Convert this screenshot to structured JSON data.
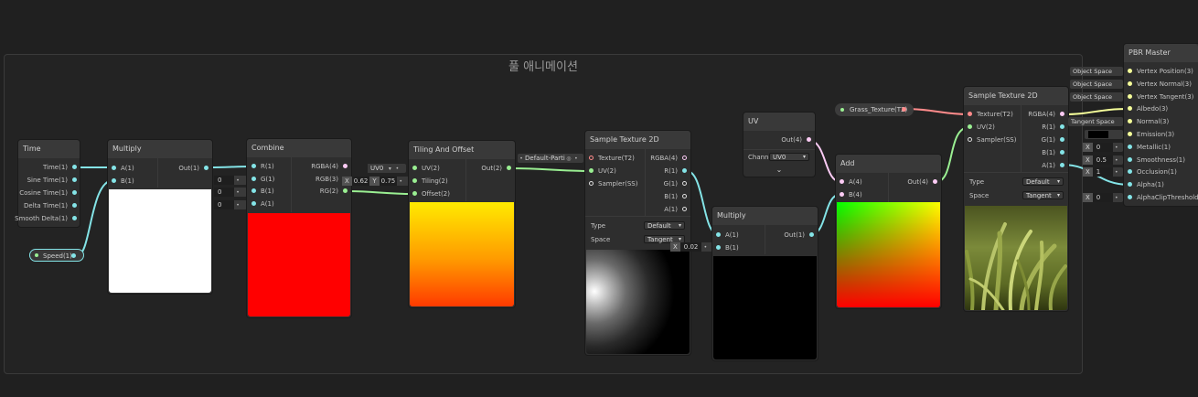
{
  "group_title": "풀 애니메이션",
  "colors": {
    "float": "#84e4e7",
    "vec2": "#9aef92",
    "vec3": "#f6ff9a",
    "vec4": "#fbcbf4",
    "texture": "#ff8b8b",
    "sampler": "#dddddd"
  },
  "time_node": {
    "title": "Time",
    "outputs": [
      "Time(1)",
      "Sine Time(1)",
      "Cosine Time(1)",
      "Delta Time(1)",
      "Smooth Delta(1)"
    ]
  },
  "speed_property": {
    "label": "Speed(1)"
  },
  "multiply1": {
    "title": "Multiply",
    "inputs": [
      "A(1)",
      "B(1)"
    ],
    "output": "Out(1)"
  },
  "combine": {
    "title": "Combine",
    "inputs": [
      "R(1)",
      "G(1)",
      "B(1)",
      "A(1)"
    ],
    "outputs": [
      "RGBA(4)",
      "RGB(3)",
      "RG(2)"
    ],
    "inline_values": [
      "0",
      "0",
      "0"
    ]
  },
  "tiling": {
    "title": "Tiling And Offset",
    "inputs": [
      "UV(2)",
      "Tiling(2)",
      "Offset(2)"
    ],
    "output": "Out(2)",
    "uv_select": "UV0",
    "tiling_x_label": "X",
    "tiling_x": "0.62",
    "tiling_y_label": "Y",
    "tiling_y": "0.75"
  },
  "sample1": {
    "title": "Sample Texture 2D",
    "inputs": [
      "Texture(T2)",
      "UV(2)",
      "Sampler(SS)"
    ],
    "outputs": [
      "RGBA(4)",
      "R(1)",
      "G(1)",
      "B(1)",
      "A(1)"
    ],
    "type_label": "Type",
    "type_value": "Default",
    "space_label": "Space",
    "space_value": "Tangent",
    "texture_input": "Default-Parti"
  },
  "multiply2": {
    "title": "Multiply",
    "inputs": [
      "A(1)",
      "B(1)"
    ],
    "output": "Out(1)",
    "b_label": "X",
    "b_value": "0.02"
  },
  "uv_node": {
    "title": "UV",
    "output": "Out(4)",
    "channel_label": "Channel",
    "channel_value": "UV0"
  },
  "add_node": {
    "title": "Add",
    "inputs": [
      "A(4)",
      "B(4)"
    ],
    "output": "Out(4)"
  },
  "grass_property": {
    "label": "Grass_Texture(T2)"
  },
  "sample2": {
    "title": "Sample Texture 2D",
    "inputs": [
      "Texture(T2)",
      "UV(2)",
      "Sampler(SS)"
    ],
    "outputs": [
      "RGBA(4)",
      "R(1)",
      "G(1)",
      "B(1)",
      "A(1)"
    ],
    "type_label": "Type",
    "type_value": "Default",
    "space_label": "Space",
    "space_value": "Tangent"
  },
  "pbr_master": {
    "title": "PBR Master",
    "inputs": [
      "Vertex Position(3)",
      "Vertex Normal(3)",
      "Vertex Tangent(3)",
      "Albedo(3)",
      "Normal(3)",
      "Emission(3)",
      "Metallic(1)",
      "Smoothness(1)",
      "Occlusion(1)",
      "Alpha(1)",
      "AlphaClipThreshold(1)"
    ],
    "space_chips": [
      "Object Space",
      "Object Space",
      "Object Space"
    ],
    "normal_chip": "Tangent Space",
    "metallic_label": "X",
    "metallic": "0",
    "smoothness_label": "X",
    "smoothness": "0.5",
    "occlusion_label": "X",
    "occlusion": "1",
    "clip_label": "X",
    "clip": "0"
  }
}
